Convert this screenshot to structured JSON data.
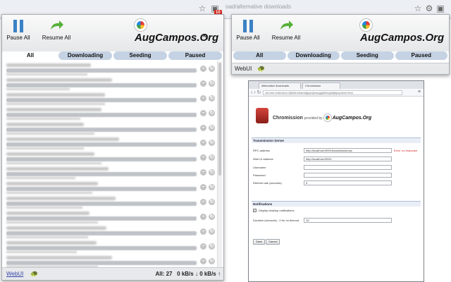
{
  "browser": {
    "url_fragment": "oad/alternative downloads",
    "badge_count": "10"
  },
  "main_popup": {
    "toolbar": {
      "pause_all_label": "Pause All",
      "resume_all_label": "Resume All"
    },
    "logo_text": "AugCampos.Org",
    "tabs": [
      "All",
      "Downloading",
      "Seeding",
      "Paused"
    ],
    "active_tab": "All",
    "row_count": 15,
    "footer": {
      "webui_label": "WebUI",
      "stats_label": "All: 27",
      "down_speed": "0 kB/s",
      "up_speed": "0 kB/s"
    }
  },
  "second_popup": {
    "toolbar": {
      "pause_all_label": "Pause All",
      "resume_all_label": "Resume All"
    },
    "logo_text": "AugCampos.Org",
    "tabs": [
      "All",
      "Downloading",
      "Seeding",
      "Paused"
    ],
    "footer": {
      "webui_label": "WebUI"
    }
  },
  "options_page": {
    "tabs": [
      "Alternative downloads",
      "Chromission"
    ],
    "address": "chrome-extension://ljhkbhnbaeadjjcpclpnacgpjhknbgiddjhj/options.html",
    "title_app": "Chromission",
    "title_middle": "provided by",
    "title_brand": "AugCampos.Org",
    "sections": {
      "server": "Transmission Server",
      "notifications": "Notifications"
    },
    "fields": {
      "rpc_label": "RPC address",
      "rpc_value": "http://localhost:9091/transmission/rpc",
      "rpc_error": "Error: no response",
      "webui_label": "Web UI address",
      "webui_value": "http://localhost:9091/",
      "username_label": "Username",
      "password_label": "Password",
      "refresh_label": "Refresh rate (seconds)",
      "refresh_value": "5",
      "notify_label": "Display desktop notifications",
      "duration_label": "Duration (seconds) - 0 for no timeout",
      "duration_value": "10"
    },
    "buttons": {
      "save": "Save",
      "cancel": "Cancel"
    }
  },
  "colors": {
    "tab_bg": "#c5d2e3",
    "link": "#3444a8",
    "error": "#d32020"
  }
}
